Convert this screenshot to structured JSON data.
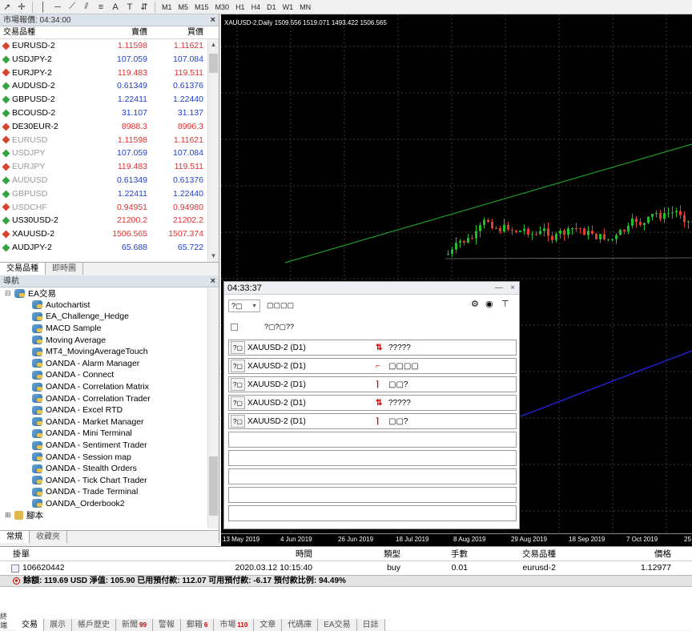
{
  "toolbar": {
    "timeframes": [
      "M1",
      "M5",
      "M15",
      "M30",
      "H1",
      "H4",
      "D1",
      "W1",
      "MN"
    ]
  },
  "market_watch": {
    "title": "市場報價: 04:34:00",
    "headers": [
      "交易品種",
      "賣價",
      "買價"
    ],
    "rows": [
      {
        "symbol": "EURUSD-2",
        "bid": "1.11598",
        "ask": "1.11621",
        "color": "#e0312f",
        "icon_color": "#d9442e",
        "dim": false
      },
      {
        "symbol": "USDJPY-2",
        "bid": "107.059",
        "ask": "107.084",
        "color": "#1f3fd1",
        "icon_color": "#35a340",
        "dim": false
      },
      {
        "symbol": "EURJPY-2",
        "bid": "119.483",
        "ask": "119.511",
        "color": "#e0312f",
        "icon_color": "#d9442e",
        "dim": false
      },
      {
        "symbol": "AUDUSD-2",
        "bid": "0.61349",
        "ask": "0.61376",
        "color": "#1f3fd1",
        "icon_color": "#35a340",
        "dim": false
      },
      {
        "symbol": "GBPUSD-2",
        "bid": "1.22411",
        "ask": "1.22440",
        "color": "#1f3fd1",
        "icon_color": "#35a340",
        "dim": false
      },
      {
        "symbol": "BCOUSD-2",
        "bid": "31.107",
        "ask": "31.137",
        "color": "#1f3fd1",
        "icon_color": "#35a340",
        "dim": false
      },
      {
        "symbol": "DE30EUR-2",
        "bid": "8988.3",
        "ask": "8996.3",
        "color": "#e0312f",
        "icon_color": "#d9442e",
        "dim": false
      },
      {
        "symbol": "EURUSD",
        "bid": "1.11598",
        "ask": "1.11621",
        "color": "#e0312f",
        "icon_color": "#d9442e",
        "dim": true
      },
      {
        "symbol": "USDJPY",
        "bid": "107.059",
        "ask": "107.084",
        "color": "#1f3fd1",
        "icon_color": "#35a340",
        "dim": true
      },
      {
        "symbol": "EURJPY",
        "bid": "119.483",
        "ask": "119.511",
        "color": "#e0312f",
        "icon_color": "#d9442e",
        "dim": true
      },
      {
        "symbol": "AUDUSD",
        "bid": "0.61349",
        "ask": "0.61376",
        "color": "#1f3fd1",
        "icon_color": "#35a340",
        "dim": true
      },
      {
        "symbol": "GBPUSD",
        "bid": "1.22411",
        "ask": "1.22440",
        "color": "#1f3fd1",
        "icon_color": "#35a340",
        "dim": true
      },
      {
        "symbol": "USDCHF",
        "bid": "0.94951",
        "ask": "0.94980",
        "color": "#e0312f",
        "icon_color": "#d9442e",
        "dim": true
      },
      {
        "symbol": "US30USD-2",
        "bid": "21200.2",
        "ask": "21202.2",
        "color": "#e0312f",
        "icon_color": "#35a340",
        "dim": false
      },
      {
        "symbol": "XAUUSD-2",
        "bid": "1506.565",
        "ask": "1507.374",
        "color": "#e0312f",
        "icon_color": "#d9442e",
        "dim": false
      },
      {
        "symbol": "AUDJPY-2",
        "bid": "65.688",
        "ask": "65.722",
        "color": "#1f3fd1",
        "icon_color": "#35a340",
        "dim": false
      }
    ],
    "tabs": [
      "交易品種",
      "即時圖"
    ]
  },
  "navigator": {
    "title": "導航",
    "root": "EA交易",
    "items": [
      "Autochartist",
      "EA_Challenge_Hedge",
      "MACD Sample",
      "Moving Average",
      "MT4_MovingAverageTouch",
      "OANDA - Alarm Manager",
      "OANDA - Connect",
      "OANDA - Correlation Matrix",
      "OANDA - Correlation Trader",
      "OANDA - Excel RTD",
      "OANDA - Market Manager",
      "OANDA - Mini Terminal",
      "OANDA - Sentiment Trader",
      "OANDA - Session map",
      "OANDA - Stealth Orders",
      "OANDA - Tick Chart Trader",
      "OANDA - Trade Terminal",
      "OANDA_Orderbook2"
    ],
    "scripts": "腳本",
    "tabs": [
      "常規",
      "收藏夾"
    ]
  },
  "chart": {
    "info": "XAUUSD-2,Daily  1509.556 1519.071 1493.422 1506.565",
    "x_labels": [
      "13 May 2019",
      "4 Jun 2019",
      "26 Jun 2019",
      "18 Jul 2019",
      "8 Aug 2019",
      "29 Aug 2019",
      "18 Sep 2019",
      "7 Oct 2019",
      "25"
    ]
  },
  "dialog": {
    "title": "04:33:37",
    "dropdown": "?▢",
    "header_text": "▢▢▢▢",
    "checkbox_label": "?▢?▢??",
    "alerts": [
      {
        "btn": "?▢",
        "name": "XAUUSD-2 (D1)",
        "icon": "⇅",
        "text": "?????"
      },
      {
        "btn": "?▢",
        "name": "XAUUSD-2 (D1)",
        "icon": "⌐",
        "text": "▢▢▢▢"
      },
      {
        "btn": "?▢",
        "name": "XAUUSD-2 (D1)",
        "icon": "⌉",
        "text": "▢▢?"
      },
      {
        "btn": "?▢",
        "name": "XAUUSD-2 (D1)",
        "icon": "⇅",
        "text": "?????"
      },
      {
        "btn": "?▢",
        "name": "XAUUSD-2 (D1)",
        "icon": "⌉",
        "text": "▢▢?"
      }
    ]
  },
  "terminal": {
    "headers": [
      "掛單",
      "時間",
      "類型",
      "手數",
      "交易品種",
      "價格"
    ],
    "order": {
      "id": "106620442",
      "time": "2020.03.12 10:15:40",
      "type": "buy",
      "lots": "0.01",
      "symbol": "eurusd-2",
      "price": "1.12977"
    },
    "balance": "餘額: 119.69 USD  淨值: 105.90  已用預付款: 112.07  可用預付款: -6.17  預付款比例: 94.49%",
    "side_label": "終端",
    "tabs": [
      {
        "label": "交易",
        "badge": ""
      },
      {
        "label": "展示",
        "badge": ""
      },
      {
        "label": "帳戶歷史",
        "badge": ""
      },
      {
        "label": "新聞",
        "badge": "99"
      },
      {
        "label": "警報",
        "badge": ""
      },
      {
        "label": "郵箱",
        "badge": "6"
      },
      {
        "label": "市場",
        "badge": "110"
      },
      {
        "label": "文章",
        "badge": ""
      },
      {
        "label": "代碼庫",
        "badge": ""
      },
      {
        "label": "EA交易",
        "badge": ""
      },
      {
        "label": "日誌",
        "badge": ""
      }
    ]
  }
}
